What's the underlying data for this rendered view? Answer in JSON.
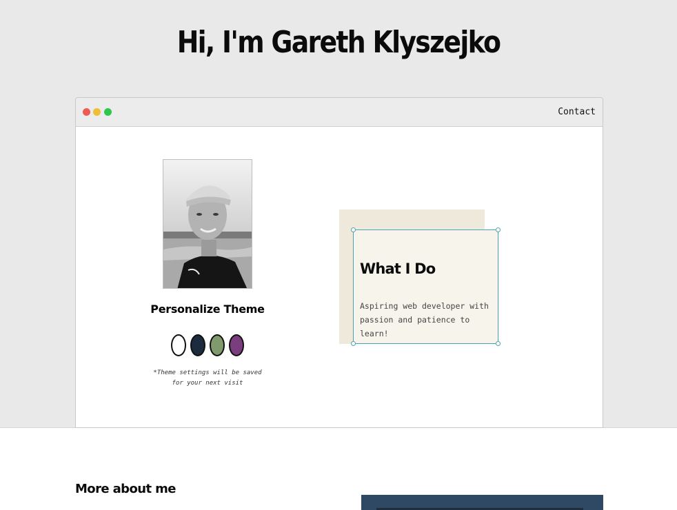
{
  "hero": {
    "title": "Hi, I'm Gareth Klyszejko"
  },
  "window": {
    "controls": [
      {
        "name": "close",
        "color": "#ed5b52"
      },
      {
        "name": "minimize",
        "color": "#f1bd36"
      },
      {
        "name": "maximize",
        "color": "#2fc74a"
      }
    ],
    "nav": {
      "contact_label": "Contact"
    }
  },
  "profile": {
    "photo_icon": "profile-photo",
    "theme_heading": "Personalize Theme",
    "theme_swatches": [
      {
        "name": "white",
        "color": "#ffffff"
      },
      {
        "name": "navy",
        "color": "#1c2b3d"
      },
      {
        "name": "sage",
        "color": "#7f9a6c"
      },
      {
        "name": "purple",
        "color": "#7a3d7e"
      }
    ],
    "theme_note": "*Theme settings will be saved for your next visit"
  },
  "what_i_do": {
    "title": "What I Do",
    "text": "Aspiring web developer with passion and patience to learn!",
    "accent_color": "#4aa3b4"
  },
  "more": {
    "heading": "More about me"
  }
}
